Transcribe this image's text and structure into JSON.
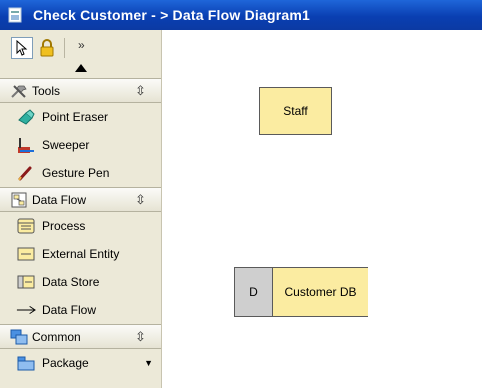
{
  "window": {
    "title": "Check Customer - > Data Flow Diagram1"
  },
  "palette": {
    "toolbar": {
      "overflow_label": "»"
    },
    "groups": [
      {
        "label": "Tools",
        "icon": "tools-icon",
        "items": [
          {
            "label": "Point Eraser",
            "icon": "eraser-icon"
          },
          {
            "label": "Sweeper",
            "icon": "sweeper-icon"
          },
          {
            "label": "Gesture Pen",
            "icon": "pen-icon"
          }
        ]
      },
      {
        "label": "Data Flow",
        "icon": "data-flow-icon",
        "items": [
          {
            "label": "Process",
            "icon": "process-icon"
          },
          {
            "label": "External Entity",
            "icon": "external-entity-icon"
          },
          {
            "label": "Data Store",
            "icon": "data-store-icon"
          },
          {
            "label": "Data Flow",
            "icon": "arrow-icon"
          }
        ]
      },
      {
        "label": "Common",
        "icon": "common-icon",
        "items": [
          {
            "label": "Package",
            "icon": "package-icon"
          }
        ]
      }
    ]
  },
  "canvas": {
    "external_entity": {
      "label": "Staff"
    },
    "data_store": {
      "id": "D",
      "label": "Customer DB"
    }
  },
  "colors": {
    "title_bar": "#0a3fb2",
    "palette_bg": "#ece9d8",
    "shape_fill": "#fbeca1",
    "datastore_id_fill": "#cfcfcf"
  }
}
